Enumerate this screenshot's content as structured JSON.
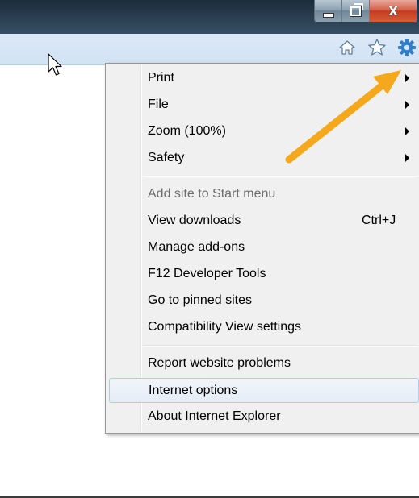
{
  "window": {
    "controls": {
      "minimize_icon": "minimize-icon",
      "maximize_icon": "restore-icon",
      "close_label": "X"
    },
    "titlebar_color": "#2a3f52"
  },
  "commandbar": {
    "icons": [
      "home-icon",
      "favorites-star-icon",
      "tools-gear-icon"
    ],
    "background": "#d2e3f4"
  },
  "tools_menu": {
    "groups": [
      [
        {
          "label": "Print",
          "submenu": true
        },
        {
          "label": "File",
          "submenu": true
        },
        {
          "label": "Zoom (100%)",
          "submenu": true
        },
        {
          "label": "Safety",
          "submenu": true
        }
      ],
      [
        {
          "label": "Add site to Start menu",
          "disabled": true
        },
        {
          "label": "View downloads",
          "shortcut": "Ctrl+J"
        },
        {
          "label": "Manage add-ons"
        },
        {
          "label": "F12 Developer Tools"
        },
        {
          "label": "Go to pinned sites"
        },
        {
          "label": "Compatibility View settings"
        }
      ],
      [
        {
          "label": "Report website problems"
        },
        {
          "label": "Internet options",
          "highlighted": true
        },
        {
          "label": "About Internet Explorer"
        }
      ]
    ]
  },
  "annotation": {
    "arrow_color": "#f5a81c",
    "points_to": "tools-gear-icon"
  }
}
